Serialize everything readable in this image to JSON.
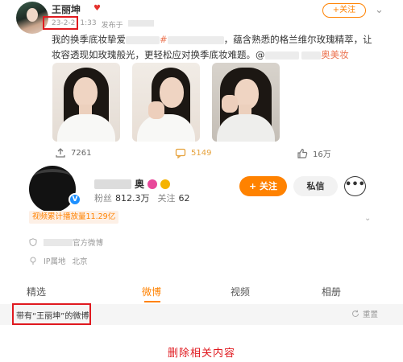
{
  "post": {
    "author_name": "王丽坤",
    "date": "23-2-2",
    "time": "1:33",
    "source_prefix": "发布于",
    "follow_label": "+关注",
    "more_glyph": "⌄",
    "text_line1_start": "我的换季底妆挚爱",
    "text_line1_end": "，蕴含熟悉的格兰维尔玫瑰精萃，让",
    "text_line2": "妆容透现如玫瑰般光，更轻松应对换季底妆难题。@",
    "text_line2_tag": "奥美妆"
  },
  "actions": {
    "share_count": "7261",
    "comment_count": "5149",
    "like_count": "16万"
  },
  "profile": {
    "verified_glyph": "V",
    "fans_label": "粉丝",
    "fans_value": "812.3万",
    "following_label": "关注",
    "following_value": "62",
    "name_suffix": "奥",
    "follow_button": "+ 关注",
    "message_button": "私信",
    "more_button": "•••",
    "video_stat": "视频累计播放量11.29亿",
    "official_label": "官方微博",
    "location_prefix": "IP属地",
    "location": "北京"
  },
  "tabs": {
    "items": [
      {
        "label": "精选"
      },
      {
        "label": "微博"
      },
      {
        "label": "视频"
      },
      {
        "label": "相册"
      }
    ]
  },
  "filter": {
    "text": "带有“王丽坤”的微博",
    "refresh_label": "重置"
  },
  "caption": "删除相关内容",
  "colors": {
    "accent": "#ff8200",
    "annotation_red": "#e0191f",
    "link": "#eb7350"
  }
}
